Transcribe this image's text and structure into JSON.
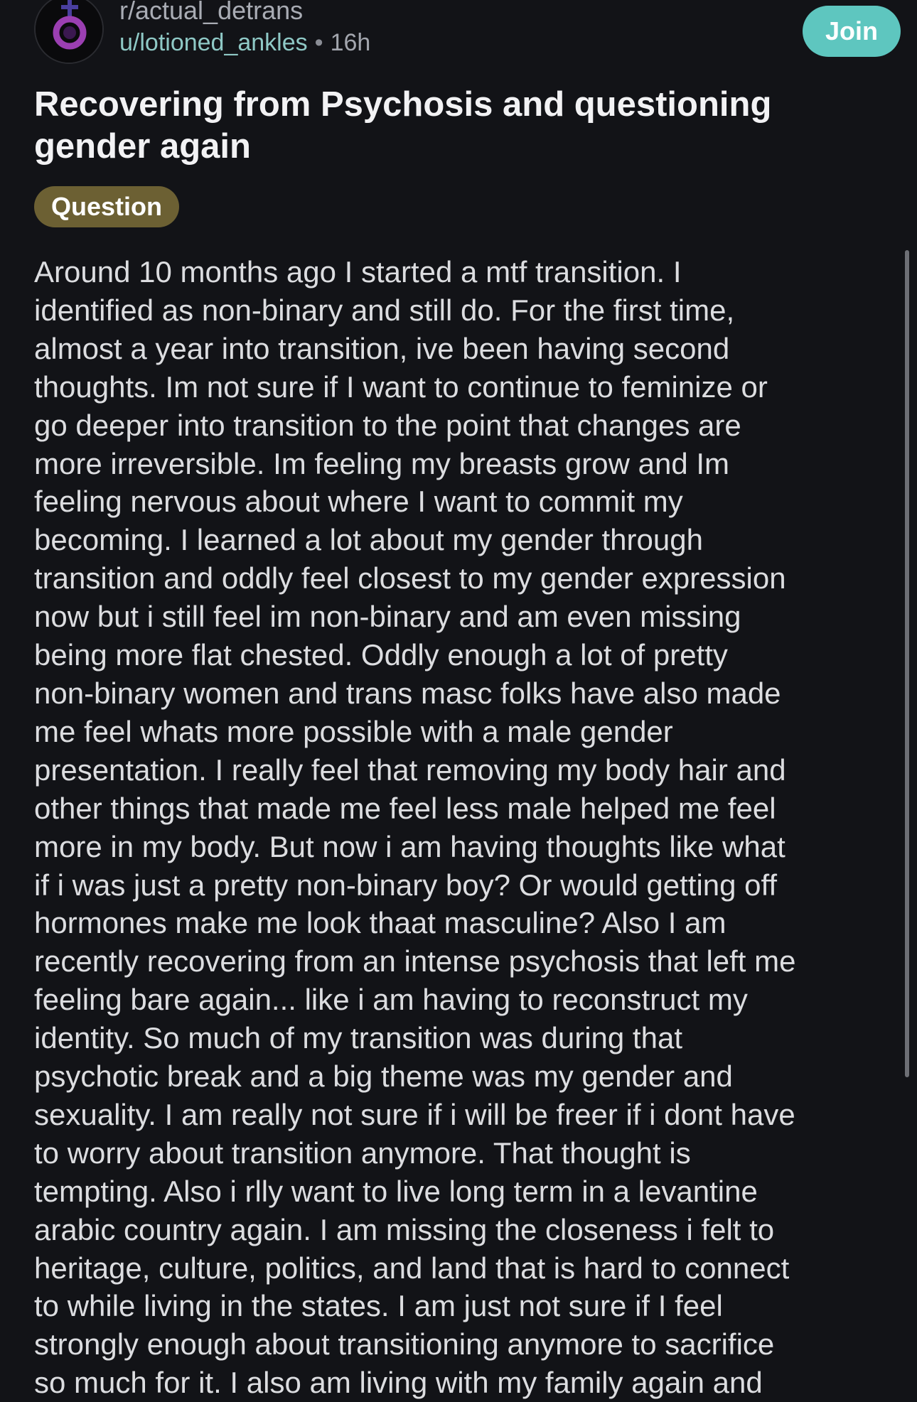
{
  "post": {
    "subreddit": "r/actual_detrans",
    "author": "u/lotioned_ankles",
    "separator": "•",
    "age": "16h",
    "join_label": "Join",
    "title": "Recovering from Psychosis and questioning gender again",
    "flair": "Question",
    "body": "Around 10 months ago I started a mtf transition. I\nidentified as non-binary and still do. For the first time,\nalmost a year into transition, ive been having second\nthoughts. Im not sure if I want to continue to feminize or\ngo deeper into transition to the point that changes are\nmore irreversible. Im feeling my breasts grow and Im\nfeeling nervous about where I want to commit my\nbecoming. I learned a lot about my gender through\ntransition and oddly feel closest to my gender expression\nnow but i still feel im non-binary and am even missing\nbeing more flat chested. Oddly enough a lot of pretty\nnon-binary women and trans masc folks have also made\nme feel whats more possible with a male gender\npresentation. I really feel that removing my body hair and\nother things that made me feel less male helped me feel\nmore in my body. But now i am having thoughts like what\nif i was just a pretty non-binary boy? Or would getting off\nhormones make me look thaat masculine? Also I am\nrecently recovering from an intense psychosis that left me\nfeeling bare again... like i am having to reconstruct my\nidentity. So much of my transition was during that\npsychotic break and a big theme was my gender and\nsexuality. I am really not sure if i will be freer if i dont have\nto worry about transition anymore. That thought is\ntempting. Also i rlly want to live long term in a levantine\narabic country again. I am missing the closeness i felt to\nheritage, culture, politics, and land that is hard to connect\nto while living in the states. I am just not sure if I feel\nstrongly enough about transitioning anymore to sacrifice\nso much for it. I also am living with my family again and"
  },
  "icons": {
    "avatar": "community-avatar-gender-symbol-icon"
  },
  "colors": {
    "background": "#121317",
    "join_button": "#5ec6bf",
    "username": "#8fc9c6",
    "flair_bg": "#6c6033",
    "avatar_symbol": "#9b3fb2"
  }
}
